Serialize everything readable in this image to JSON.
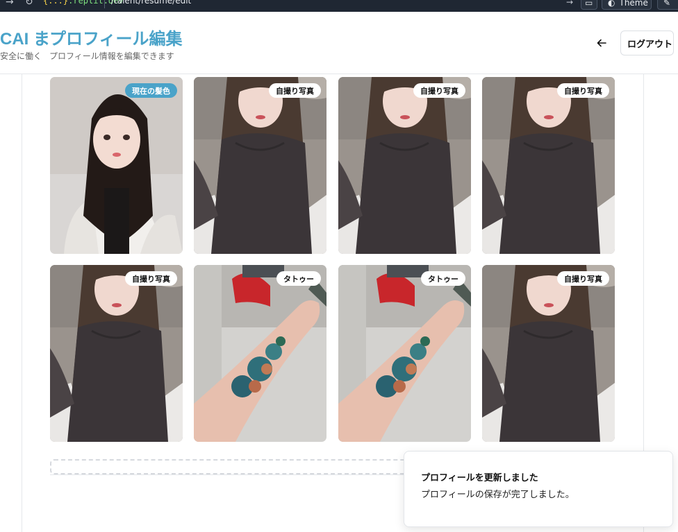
{
  "browser": {
    "url_host_brace": "{...}",
    "url_host": ".replit.dev",
    "url_path": "/talent/resume/edit",
    "theme_label": "Theme"
  },
  "header": {
    "brand_fragment": "CAI ま",
    "brand_sub_fragment": "安全に働くた",
    "page_title": "プロフィール編集",
    "page_subtitle": "プロフィール情報を編集できます",
    "back_icon": "arrow-left-icon",
    "logout_label": "ログアウト"
  },
  "photos": [
    {
      "badge": "現在の髪色",
      "type": "current",
      "scene": "portrait"
    },
    {
      "badge": "自撮り写真",
      "type": "normal",
      "scene": "selfie"
    },
    {
      "badge": "自撮り写真",
      "type": "normal",
      "scene": "selfie"
    },
    {
      "badge": "自撮り写真",
      "type": "normal",
      "scene": "selfie"
    },
    {
      "badge": "自撮り写真",
      "type": "normal",
      "scene": "selfie"
    },
    {
      "badge": "タトゥー",
      "type": "normal",
      "scene": "tattoo"
    },
    {
      "badge": "タトゥー",
      "type": "normal",
      "scene": "tattoo"
    },
    {
      "badge": "自撮り写真",
      "type": "normal",
      "scene": "selfie"
    }
  ],
  "toast": {
    "title": "プロフィールを更新しました",
    "description": "プロフィールの保存が完了しました。"
  },
  "colors": {
    "accent": "#4aa3c9",
    "browser_bar": "#1f2733"
  }
}
